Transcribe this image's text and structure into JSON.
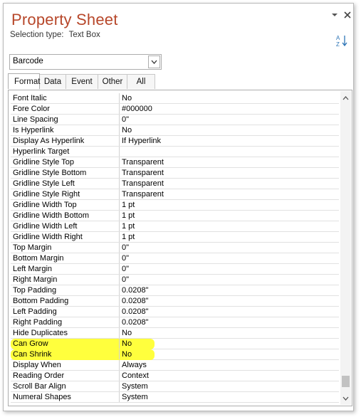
{
  "panel": {
    "title": "Property Sheet",
    "selection_label": "Selection type:",
    "selection_value": "Text Box",
    "control_combo_value": "Barcode"
  },
  "icons": {
    "dropdown": "chevron-down-icon",
    "close": "close-icon",
    "sort": "sort-az-icon"
  },
  "tabs": [
    "Format",
    "Data",
    "Event",
    "Other",
    "All"
  ],
  "active_tab": "Format",
  "properties": [
    {
      "name": "Font Italic",
      "value": "No"
    },
    {
      "name": "Fore Color",
      "value": "#000000"
    },
    {
      "name": "Line Spacing",
      "value": "0\""
    },
    {
      "name": "Is Hyperlink",
      "value": "No"
    },
    {
      "name": "Display As Hyperlink",
      "value": "If Hyperlink"
    },
    {
      "name": "Hyperlink Target",
      "value": ""
    },
    {
      "name": "Gridline Style Top",
      "value": "Transparent"
    },
    {
      "name": "Gridline Style Bottom",
      "value": "Transparent"
    },
    {
      "name": "Gridline Style Left",
      "value": "Transparent"
    },
    {
      "name": "Gridline Style Right",
      "value": "Transparent"
    },
    {
      "name": "Gridline Width Top",
      "value": "1 pt"
    },
    {
      "name": "Gridline Width Bottom",
      "value": "1 pt"
    },
    {
      "name": "Gridline Width Left",
      "value": "1 pt"
    },
    {
      "name": "Gridline Width Right",
      "value": "1 pt"
    },
    {
      "name": "Top Margin",
      "value": "0\""
    },
    {
      "name": "Bottom Margin",
      "value": "0\""
    },
    {
      "name": "Left Margin",
      "value": "0\""
    },
    {
      "name": "Right Margin",
      "value": "0\""
    },
    {
      "name": "Top Padding",
      "value": "0.0208\""
    },
    {
      "name": "Bottom Padding",
      "value": "0.0208\""
    },
    {
      "name": "Left Padding",
      "value": "0.0208\""
    },
    {
      "name": "Right Padding",
      "value": "0.0208\""
    },
    {
      "name": "Hide Duplicates",
      "value": "No"
    },
    {
      "name": "Can Grow",
      "value": "No",
      "highlighted": true
    },
    {
      "name": "Can Shrink",
      "value": "No",
      "highlighted": true
    },
    {
      "name": "Display When",
      "value": "Always"
    },
    {
      "name": "Reading Order",
      "value": "Context"
    },
    {
      "name": "Scroll Bar Align",
      "value": "System"
    },
    {
      "name": "Numeral Shapes",
      "value": "System"
    }
  ],
  "colors": {
    "title": "#b7472a",
    "highlight": "#ffff33"
  },
  "scroll_position": 0.98
}
